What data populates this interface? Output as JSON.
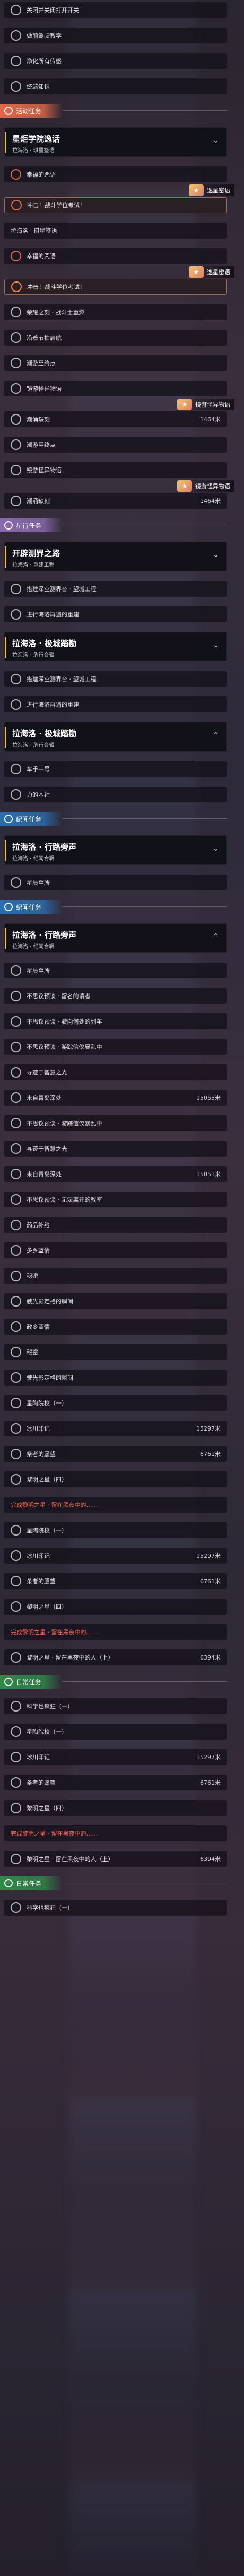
{
  "colors": {
    "event": "#e06a4a",
    "star": "#8a6bb0",
    "companion": "#2a6fb0",
    "daily": "#2f8a4a",
    "warn": "#ff6a5a"
  },
  "categories": {
    "event": "活动任务",
    "star": "星行任务",
    "companion": "纪闻任务",
    "daily": "日常任务"
  },
  "items": [
    {
      "t": "row",
      "label": "关闭并关闭打开开关",
      "ico": "white"
    },
    {
      "t": "row",
      "label": "做前驾驶教学",
      "ico": "white"
    },
    {
      "t": "row",
      "label": "净化所有传感",
      "ico": "white"
    },
    {
      "t": "row",
      "label": "终端知识",
      "ico": "white"
    },
    {
      "t": "header",
      "key": "event"
    },
    {
      "t": "card",
      "title": "星炬学院逸话",
      "sub": "拉海洛 · 琪星签语",
      "icon": "⌄"
    },
    {
      "t": "row",
      "label": "幸福的咒语",
      "ico": "red"
    },
    {
      "t": "badge",
      "label": "逸星密语"
    },
    {
      "t": "row",
      "label": "冲击！战斗学位考试！",
      "ico": "red",
      "sel": true
    },
    {
      "t": "row",
      "label": "拉海洛 · 琪星签语",
      "ico": "none"
    },
    {
      "t": "row",
      "label": "幸福的咒语",
      "ico": "red"
    },
    {
      "t": "badge",
      "label": "逸星密语"
    },
    {
      "t": "row",
      "label": "冲击！战斗学位考试！",
      "ico": "orange",
      "sel": true
    },
    {
      "t": "row",
      "label": "荣耀之刻 · 战斗士重燃",
      "ico": "white"
    },
    {
      "t": "row",
      "label": "沿着节拍启航",
      "ico": "white"
    },
    {
      "t": "row",
      "label": "潮游至终点",
      "ico": "white"
    },
    {
      "t": "row",
      "label": "镜游怪异物语",
      "ico": "white"
    },
    {
      "t": "badge",
      "label": "镜游怪异物语"
    },
    {
      "t": "row",
      "label": "潮涌缺刻",
      "ico": "white",
      "dist": "1464米"
    },
    {
      "t": "row",
      "label": "潮游至终点",
      "ico": "white"
    },
    {
      "t": "row",
      "label": "镜游怪异物语",
      "ico": "white"
    },
    {
      "t": "badge",
      "label": "镜游怪异物语"
    },
    {
      "t": "row",
      "label": "潮涌缺刻",
      "ico": "white",
      "dist": "1464米"
    },
    {
      "t": "header",
      "key": "star"
    },
    {
      "t": "card",
      "title": "开辟测界之路",
      "sub": "拉海洛 · 重建工程",
      "icon": "⌄"
    },
    {
      "t": "row",
      "label": "搭建深空测界台 · 望城工程",
      "ico": "white"
    },
    {
      "t": "row",
      "label": "进行海洛再遇的重建",
      "ico": "white"
    },
    {
      "t": "card",
      "title": "拉海洛 · 极城踏勘",
      "sub": "拉海洛 · 危行合辑",
      "icon": "⌄"
    },
    {
      "t": "row",
      "label": "搭建深空测界台 · 望城工程",
      "ico": "white"
    },
    {
      "t": "row",
      "label": "进行海洛再遇的重建",
      "ico": "white"
    },
    {
      "t": "card",
      "title": "拉海洛 · 极城踏勘",
      "sub": "拉海洛 · 危行合辑",
      "icon": "⌃"
    },
    {
      "t": "row",
      "label": "车手一号",
      "ico": "white"
    },
    {
      "t": "row",
      "label": "力的本社",
      "ico": "white"
    },
    {
      "t": "header",
      "key": "companion"
    },
    {
      "t": "card",
      "title": "拉海洛 · 行路旁声",
      "sub": "拉海洛 · 纪闻合辑",
      "icon": "⌄"
    },
    {
      "t": "row",
      "label": "星辰至所",
      "ico": "white"
    },
    {
      "t": "header",
      "key": "companion"
    },
    {
      "t": "card",
      "title": "拉海洛 · 行路旁声",
      "sub": "拉海洛 · 纪闻合辑",
      "icon": "⌃"
    },
    {
      "t": "row",
      "label": "星辰至所",
      "ico": "white"
    },
    {
      "t": "row",
      "label": "不思议预谈 · 留名的请者",
      "ico": "white"
    },
    {
      "t": "row",
      "label": "不思议预谈 · 驶向何处的列车",
      "ico": "white"
    },
    {
      "t": "row",
      "label": "不思议预谈 · 游踪信仪暴乱中",
      "ico": "white"
    },
    {
      "t": "row",
      "label": "寻迹于智慧之光",
      "ico": "white"
    },
    {
      "t": "row",
      "label": "来自青岛深处",
      "ico": "white",
      "dist": "15055米"
    },
    {
      "t": "row",
      "label": "不思议预谈 · 游踪信仪暴乱中",
      "ico": "white"
    },
    {
      "t": "row",
      "label": "寻迹于智慧之光",
      "ico": "white"
    },
    {
      "t": "row",
      "label": "来自青岛深处",
      "ico": "white",
      "dist": "15051米"
    },
    {
      "t": "row",
      "label": "不思议预谈 · 无法离开的教室",
      "ico": "white"
    },
    {
      "t": "row",
      "label": "药品补给",
      "ico": "white"
    },
    {
      "t": "row",
      "label": "多乡蓝情",
      "ico": "white"
    },
    {
      "t": "row",
      "label": "秘密",
      "ico": "white"
    },
    {
      "t": "row",
      "label": "驶光影定格的瞬间",
      "ico": "white"
    },
    {
      "t": "row",
      "label": "政乡蓝情",
      "ico": "white"
    },
    {
      "t": "row",
      "label": "秘密",
      "ico": "white"
    },
    {
      "t": "row",
      "label": "驶光影定格的瞬间",
      "ico": "white"
    },
    {
      "t": "row",
      "label": "星陶院校（一）",
      "ico": "white"
    },
    {
      "t": "row",
      "label": "冰川印记",
      "ico": "white",
      "dist": "15297米"
    },
    {
      "t": "row",
      "label": "条者的愿望",
      "ico": "white",
      "dist": "6761米"
    },
    {
      "t": "row",
      "label": "黎明之星（四）",
      "ico": "white"
    },
    {
      "t": "row",
      "label": "完成黎明之星 · 留在黑夜中的……",
      "ico": "none",
      "red": true
    },
    {
      "t": "row",
      "label": "星陶院校（一）",
      "ico": "white"
    },
    {
      "t": "row",
      "label": "冰川印记",
      "ico": "white",
      "dist": "15297米"
    },
    {
      "t": "row",
      "label": "条者的愿望",
      "ico": "white",
      "dist": "6761米"
    },
    {
      "t": "row",
      "label": "黎明之星（四）",
      "ico": "white"
    },
    {
      "t": "row",
      "label": "完成黎明之星 · 留在黑夜中的……",
      "ico": "none",
      "red": true
    },
    {
      "t": "row",
      "label": "黎明之星 · 留在黑夜中的人（上）",
      "ico": "white",
      "dist": "6394米"
    },
    {
      "t": "header",
      "key": "daily"
    },
    {
      "t": "row",
      "label": "科学也疯狂（一）",
      "ico": "white"
    },
    {
      "t": "row",
      "label": "星陶院校（一）",
      "ico": "white"
    },
    {
      "t": "row",
      "label": "冰川印记",
      "ico": "white",
      "dist": "15297米"
    },
    {
      "t": "row",
      "label": "条者的愿望",
      "ico": "white",
      "dist": "6761米"
    },
    {
      "t": "row",
      "label": "黎明之星（四）",
      "ico": "white"
    },
    {
      "t": "row",
      "label": "完成黎明之星 · 留在黑夜中的……",
      "ico": "none",
      "red": true
    },
    {
      "t": "row",
      "label": "黎明之星 · 留在黑夜中的人（上）",
      "ico": "white",
      "dist": "6394米"
    },
    {
      "t": "header",
      "key": "daily"
    },
    {
      "t": "row",
      "label": "科学也疯狂（一）",
      "ico": "white"
    }
  ]
}
